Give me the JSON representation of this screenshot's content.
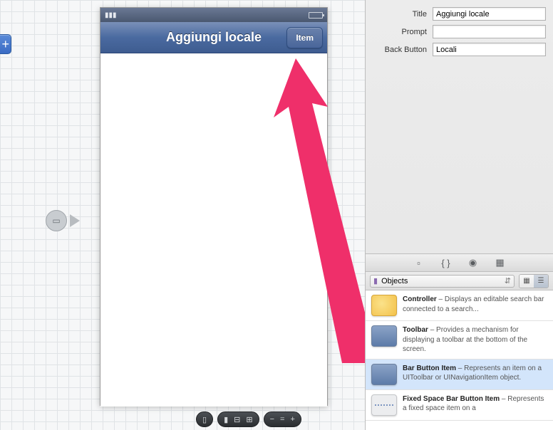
{
  "inspector": {
    "title_label": "Title",
    "title_value": "Aggiungi locale",
    "prompt_label": "Prompt",
    "prompt_value": "",
    "back_label": "Back Button",
    "back_value": "Locali"
  },
  "phone": {
    "nav_title": "Aggiungi locale",
    "nav_button": "Item"
  },
  "library": {
    "filter_label": "Objects",
    "items": [
      {
        "title": "Controller",
        "desc": " – Displays an editable search bar connected to a search..."
      },
      {
        "title": "Toolbar",
        "desc": " – Provides a mechanism for displaying a toolbar at the bottom of the screen."
      },
      {
        "title": "Bar Button Item",
        "desc": " – Represents an item on a UIToolbar or UINavigationItem object."
      },
      {
        "title": "Fixed Space Bar Button Item",
        "desc": " – Represents a fixed space item on a"
      }
    ]
  }
}
